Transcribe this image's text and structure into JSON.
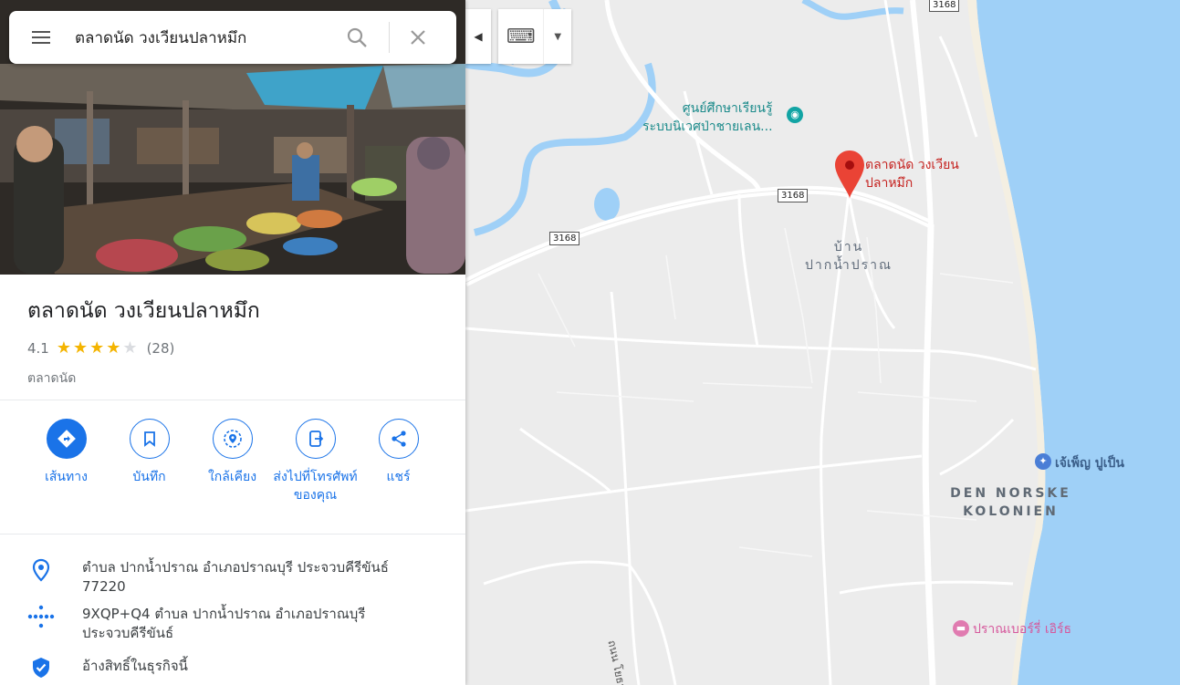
{
  "search": {
    "query": "ตลาดนัด วงเวียนปลาหมึก"
  },
  "place": {
    "title": "ตลาดนัด วงเวียนปลาหมึก",
    "rating": "4.1",
    "rating_value": 4.1,
    "review_count": "(28)",
    "category": "ตลาดนัด"
  },
  "actions": [
    {
      "label": "เส้นทาง",
      "icon": "directions-icon"
    },
    {
      "label": "บันทึก",
      "icon": "bookmark-icon"
    },
    {
      "label": "ใกล้เคียง",
      "icon": "nearby-icon"
    },
    {
      "label": "ส่งไปที่โทรศัพท์ของคุณ",
      "icon": "send-to-phone-icon"
    },
    {
      "label": "แชร์",
      "icon": "share-icon"
    }
  ],
  "details": {
    "address": "ตำบล ปากน้ำปราณ อำเภอปราณบุรี ประจวบคีรีขันธ์ 77220",
    "plus_code": "9XQP+Q4 ตำบล ปากน้ำปราณ อำเภอปราณบุรี ประจวบคีรีขันธ์",
    "claim": "อ้างสิทธิ์ในธุรกิจนี้"
  },
  "map": {
    "labels": {
      "learning_center_1": "ศูนย์ศึกษาเรียนรู้",
      "learning_center_2": "ระบบนิเวศป่าชายเลน...",
      "market_1": "ตลาดนัด วงเวียน",
      "market_2": "ปลาหมึก",
      "village_1": "บ้าน",
      "village_2": "ปากน้ำปราณ",
      "jaoping": "เจ้เพ็ญ ปูเป็น",
      "den_norske_1": "DEN NORSKE",
      "den_norske_2": "KOLONIEN",
      "resort": "ปราณเบอร์รี่ เอิร์ธ",
      "road_name": "ถนน โยธา"
    },
    "road_shields": [
      "3168",
      "3168",
      "3168"
    ]
  },
  "colors": {
    "accent": "#1a73e8",
    "marker": "#ea4335",
    "water": "#9fd0f7",
    "star": "#f4b400"
  }
}
